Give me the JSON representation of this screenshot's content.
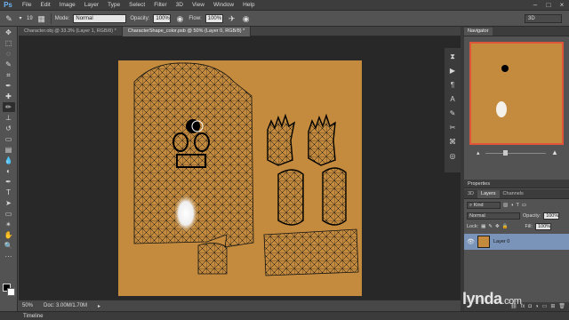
{
  "app": {
    "logo": "Ps"
  },
  "menu": [
    "File",
    "Edit",
    "Image",
    "Layer",
    "Type",
    "Select",
    "Filter",
    "3D",
    "View",
    "Window",
    "Help"
  ],
  "window_controls": [
    "minimize-icon",
    "maximize-icon",
    "close-icon"
  ],
  "options_bar": {
    "brush_size": "19",
    "mode_label": "Mode:",
    "mode_value": "Normal",
    "opacity_label": "Opacity:",
    "opacity_value": "100%",
    "flow_label": "Flow:",
    "flow_value": "100%",
    "workspace": "3D"
  },
  "doc_tabs": [
    {
      "label": "Character.obj @ 33.3% (Layer 1, RGB/8) *",
      "active": false
    },
    {
      "label": "CharacterShape_color.psb @ 50% (Layer 0, RGB/8) *",
      "active": true
    }
  ],
  "status": {
    "zoom": "50%",
    "doc_info": "Doc: 3.00M/1.70M"
  },
  "timeline_label": "Timeline",
  "panels": {
    "navigator_tab": "Navigator",
    "properties_label": "Properties",
    "layer_tabs": [
      "3D",
      "Layers",
      "Channels"
    ],
    "kind_label": "Kind",
    "blend_mode": "Normal",
    "opacity_label": "Opacity:",
    "opacity_value": "100%",
    "lock_label": "Lock:",
    "fill_label": "Fill:",
    "fill_value": "100%",
    "layer_name": "Layer 0"
  },
  "watermark": {
    "brand": "lynda",
    "suffix": ".com"
  },
  "colors": {
    "texture": "#c48b3e",
    "mesh": "#000000",
    "nav_frame": "#e0553a",
    "selected_layer": "#7a93b8"
  }
}
